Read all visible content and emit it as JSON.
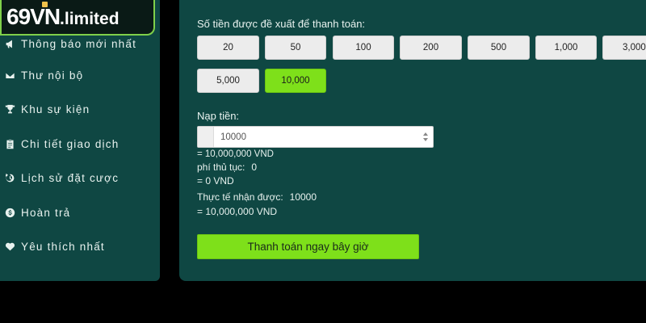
{
  "logo": {
    "main": "69VN",
    "sub": ".limited"
  },
  "sidebar": {
    "items": [
      {
        "label": "Thông báo mới nhất",
        "icon": "megaphone-icon"
      },
      {
        "label": "Thư nội bộ",
        "icon": "envelope-icon"
      },
      {
        "label": "Khu sự kiện",
        "icon": "trophy-icon"
      },
      {
        "label": "Chi tiết giao dịch",
        "icon": "clipboard-icon"
      },
      {
        "label": "Lịch sử đặt cược",
        "icon": "history-icon"
      },
      {
        "label": "Hoàn trả",
        "icon": "dollar-coin-icon"
      },
      {
        "label": "Yêu thích nhất",
        "icon": "heart-icon"
      }
    ]
  },
  "deposit": {
    "suggested_label": "Số tiền được đề xuất để thanh toán:",
    "amounts": [
      "20",
      "50",
      "100",
      "200",
      "500",
      "1,000",
      "3,000",
      "5,000",
      "10,000"
    ],
    "selected_amount": "10,000",
    "deposit_label": "Nạp tiền:",
    "input_value": "10000",
    "input_equiv": "= 10,000,000 VND",
    "fee_label": "phí thủ tục:",
    "fee_value": "0",
    "fee_equiv": "= 0 VND",
    "actual_label": "Thực tế nhận được:",
    "actual_value": "10000",
    "actual_equiv": "= 10,000,000 VND",
    "pay_button": "Thanh toán ngay bây giờ"
  },
  "colors": {
    "panel_bg": "#0f4743",
    "accent_green": "#7ee01a",
    "background": "#000000"
  }
}
